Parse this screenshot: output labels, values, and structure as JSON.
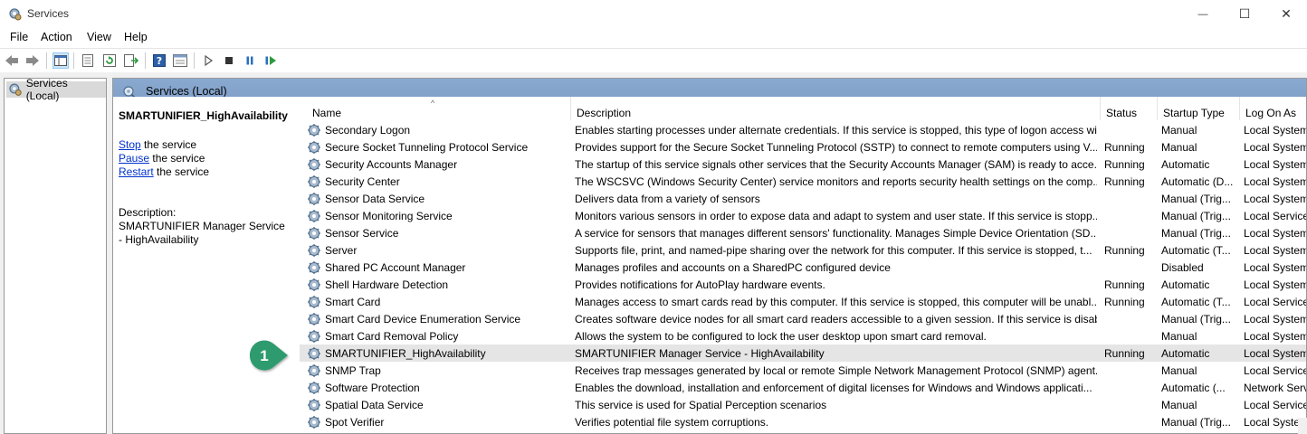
{
  "window": {
    "title": "Services",
    "minimize": "—",
    "maximize": "☐",
    "close": "✕"
  },
  "menu": [
    "File",
    "Action",
    "View",
    "Help"
  ],
  "toolbar_icons": [
    "back-icon",
    "forward-icon",
    "show-tree-icon",
    "properties-icon",
    "refresh-icon",
    "export-icon",
    "help-icon",
    "view-icon",
    "play-icon",
    "stop-icon",
    "pause-icon",
    "resume-icon"
  ],
  "tree": {
    "root_label": "Services (Local)"
  },
  "panel": {
    "header_title": "Services (Local)",
    "selected_service": "SMARTUNIFIER_HighAvailability",
    "actions": [
      {
        "link": "Stop",
        "rest": " the service"
      },
      {
        "link": "Pause",
        "rest": " the service"
      },
      {
        "link": "Restart",
        "rest": " the service"
      }
    ],
    "description_label": "Description:",
    "description_text": "SMARTUNIFIER Manager Service - HighAvailability"
  },
  "columns": {
    "name": "Name",
    "description": "Description",
    "status": "Status",
    "startup_type": "Startup Type",
    "log_on_as": "Log On As"
  },
  "sort_indicator": "^",
  "rows": [
    {
      "name": "Secondary Logon",
      "description": "Enables starting processes under alternate credentials. If this service is stopped, this type of logon access wi...",
      "status": "",
      "startup": "Manual",
      "logon": "Local System"
    },
    {
      "name": "Secure Socket Tunneling Protocol Service",
      "description": "Provides support for the Secure Socket Tunneling Protocol (SSTP) to connect to remote computers using V...",
      "status": "Running",
      "startup": "Manual",
      "logon": "Local System"
    },
    {
      "name": "Security Accounts Manager",
      "description": "The startup of this service signals other services that the Security Accounts Manager (SAM) is ready to acce...",
      "status": "Running",
      "startup": "Automatic",
      "logon": "Local System"
    },
    {
      "name": "Security Center",
      "description": "The WSCSVC (Windows Security Center) service monitors and reports security health settings on the comp...",
      "status": "Running",
      "startup": "Automatic (D...",
      "logon": "Local System"
    },
    {
      "name": "Sensor Data Service",
      "description": "Delivers data from a variety of sensors",
      "status": "",
      "startup": "Manual (Trig...",
      "logon": "Local System"
    },
    {
      "name": "Sensor Monitoring Service",
      "description": "Monitors various sensors in order to expose data and adapt to system and user state.  If this service is stopp...",
      "status": "",
      "startup": "Manual (Trig...",
      "logon": "Local Service"
    },
    {
      "name": "Sensor Service",
      "description": "A service for sensors that manages different sensors' functionality. Manages Simple Device Orientation (SD...",
      "status": "",
      "startup": "Manual (Trig...",
      "logon": "Local System"
    },
    {
      "name": "Server",
      "description": "Supports file, print, and named-pipe sharing over the network for this computer. If this service is stopped, t...",
      "status": "Running",
      "startup": "Automatic (T...",
      "logon": "Local System"
    },
    {
      "name": "Shared PC Account Manager",
      "description": "Manages profiles and accounts on a SharedPC configured device",
      "status": "",
      "startup": "Disabled",
      "logon": "Local System"
    },
    {
      "name": "Shell Hardware Detection",
      "description": "Provides notifications for AutoPlay hardware events.",
      "status": "Running",
      "startup": "Automatic",
      "logon": "Local System"
    },
    {
      "name": "Smart Card",
      "description": "Manages access to smart cards read by this computer. If this service is stopped, this computer will be unabl...",
      "status": "Running",
      "startup": "Automatic (T...",
      "logon": "Local Service"
    },
    {
      "name": "Smart Card Device Enumeration Service",
      "description": "Creates software device nodes for all smart card readers accessible to a given session. If this service is disabl...",
      "status": "",
      "startup": "Manual (Trig...",
      "logon": "Local System"
    },
    {
      "name": "Smart Card Removal Policy",
      "description": "Allows the system to be configured to lock the user desktop upon smart card removal.",
      "status": "",
      "startup": "Manual",
      "logon": "Local System"
    },
    {
      "name": "SMARTUNIFIER_HighAvailability",
      "description": "SMARTUNIFIER Manager Service - HighAvailability",
      "status": "Running",
      "startup": "Automatic",
      "logon": "Local System"
    },
    {
      "name": "SNMP Trap",
      "description": "Receives trap messages generated by local or remote Simple Network Management Protocol (SNMP) agent...",
      "status": "",
      "startup": "Manual",
      "logon": "Local Service"
    },
    {
      "name": "Software Protection",
      "description": "Enables the download, installation and enforcement of digital licenses for Windows and Windows applicati...",
      "status": "",
      "startup": "Automatic (...",
      "logon": "Network Service"
    },
    {
      "name": "Spatial Data Service",
      "description": "This service is used for Spatial Perception scenarios",
      "status": "",
      "startup": "Manual",
      "logon": "Local Service"
    },
    {
      "name": "Spot Verifier",
      "description": "Verifies potential file system corruptions.",
      "status": "",
      "startup": "Manual (Trig...",
      "logon": "Local System"
    }
  ],
  "selected_row_index": 13,
  "callout": {
    "label": "1",
    "color": "#2e9b6e"
  }
}
